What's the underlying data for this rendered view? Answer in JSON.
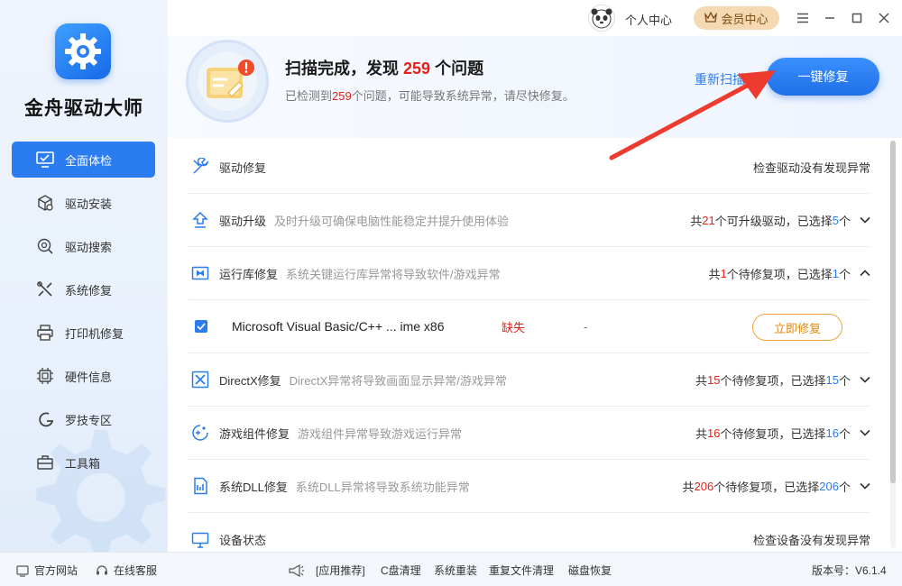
{
  "app": {
    "title": "金舟驱动大师"
  },
  "sidebar": {
    "items": [
      {
        "label": "全面体检",
        "icon": "monitor-check-icon",
        "active": true
      },
      {
        "label": "驱动安装",
        "icon": "box-gear-icon"
      },
      {
        "label": "驱动搜索",
        "icon": "search-gear-icon"
      },
      {
        "label": "系统修复",
        "icon": "tools-icon"
      },
      {
        "label": "打印机修复",
        "icon": "printer-icon"
      },
      {
        "label": "硬件信息",
        "icon": "chip-icon"
      },
      {
        "label": "罗技专区",
        "icon": "logitech-icon"
      },
      {
        "label": "工具箱",
        "icon": "toolbox-icon"
      }
    ]
  },
  "titlebar": {
    "personal_label": "个人中心",
    "vip_label": "会员中心"
  },
  "banner": {
    "title_prefix": "扫描完成，发现",
    "title_count": "259",
    "title_suffix": "个问题",
    "sub_prefix": "已检测到",
    "sub_count": "259",
    "sub_suffix": "个问题，可能导致系统异常，请尽快修复。",
    "rescan_label": "重新扫描",
    "fix_all_label": "一键修复"
  },
  "list": {
    "rows": [
      {
        "title": "驱动修复",
        "desc": "",
        "icon": "wrench-screwdriver-icon",
        "right_text": "检查驱动没有发现异常"
      },
      {
        "title": "驱动升级",
        "desc": "及时升级可确保电脑性能稳定并提升使用体验",
        "icon": "upgrade-arrow-icon",
        "r1": "共",
        "r_count": "21",
        "r2": "个可升级驱动，已选择",
        "r_sel": "5",
        "r3": "个"
      },
      {
        "title": "运行库修复",
        "desc": "系统关键运行库异常将导致软件/游戏异常",
        "icon": "runtime-icon",
        "r1": "共",
        "r_count": "1",
        "r2": "个待修复项，已选择",
        "r_sel": "1",
        "r3": "个"
      },
      {
        "title": "DirectX修复",
        "desc": "DirectX异常将导致画面显示异常/游戏异常",
        "icon": "directx-icon",
        "r1": "共",
        "r_count": "15",
        "r2": "个待修复项，已选择",
        "r_sel": "15",
        "r3": "个"
      },
      {
        "title": "游戏组件修复",
        "desc": "游戏组件异常导致游戏运行异常",
        "icon": "gamepad-icon",
        "r1": "共",
        "r_count": "16",
        "r2": "个待修复项，已选择",
        "r_sel": "16",
        "r3": "个"
      },
      {
        "title": "系统DLL修复",
        "desc": "系统DLL异常将导致系统功能异常",
        "icon": "dll-icon",
        "r1": "共",
        "r_count": "206",
        "r2": "个待修复项，已选择",
        "r_sel": "206",
        "r3": "个"
      },
      {
        "title": "设备状态",
        "desc": "",
        "icon": "monitor-icon",
        "right_text": "检查设备没有发现异常"
      }
    ],
    "sub_item": {
      "name": "Microsoft Visual Basic/C++ ... ime x86",
      "status": "缺失",
      "dash": "-",
      "fix_label": "立即修复"
    }
  },
  "footer": {
    "website": "官方网站",
    "support": "在线客服",
    "recommend": "[应用推荐]",
    "links": [
      "C盘清理",
      "系统重装",
      "重复文件清理",
      "磁盘恢复"
    ],
    "version": "版本号：V6.1.4"
  },
  "colors": {
    "accent": "#2b7cf0",
    "danger": "#e2231a",
    "warning": "#f0a23b"
  }
}
